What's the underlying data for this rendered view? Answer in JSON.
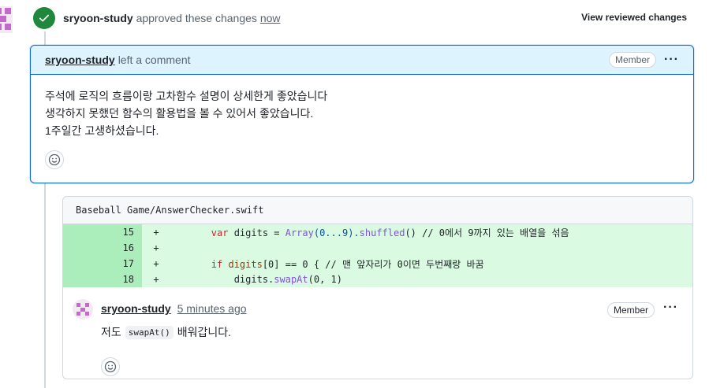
{
  "review": {
    "user": "sryoon-study",
    "action": "approved these changes",
    "time": "now",
    "view_changes": "View reviewed changes"
  },
  "comment": {
    "user": "sryoon-study",
    "action": "left a comment",
    "badge": "Member",
    "lines": [
      "주석에 로직의 흐름이랑 고차함수 설명이 상세한게 좋았습니다",
      "생각하지 못했던 함수의 활용법을 볼 수 있어서 좋았습니다.",
      "1주일간 고생하셨습니다."
    ]
  },
  "diff": {
    "file": "Baseball Game/AnswerChecker.swift",
    "line_numbers": [
      "15",
      "16",
      "17",
      "18"
    ],
    "signs": [
      "+",
      "+",
      "+",
      "+"
    ],
    "code": {
      "l15": {
        "indent": "        ",
        "kw": "var",
        "name": " digits = ",
        "type": "Array",
        "mid": "(0...9).",
        "fn": "shuffled",
        "tail": "() // 0에서 9까지 있는 배열을 섞음"
      },
      "l16": "",
      "l17": {
        "indent": "        ",
        "kw": "if",
        "name": " digits",
        "tail": "[0] == 0 { // 맨 앞자리가 0이면 두번째랑 바꿈"
      },
      "l18": {
        "indent": "            ",
        "var": "digits.",
        "fn": "swapAt",
        "tail": "(0, 1)"
      }
    }
  },
  "reply": {
    "user": "sryoon-study",
    "time": "5 minutes ago",
    "badge": "Member",
    "text_before": "저도",
    "code": "swapAt()",
    "text_after": "배워갑니다."
  },
  "colors": {
    "accent": "#0969da",
    "success": "#1f883d",
    "diff_add": "#dafbe1",
    "diff_add_num": "#aceebb"
  }
}
